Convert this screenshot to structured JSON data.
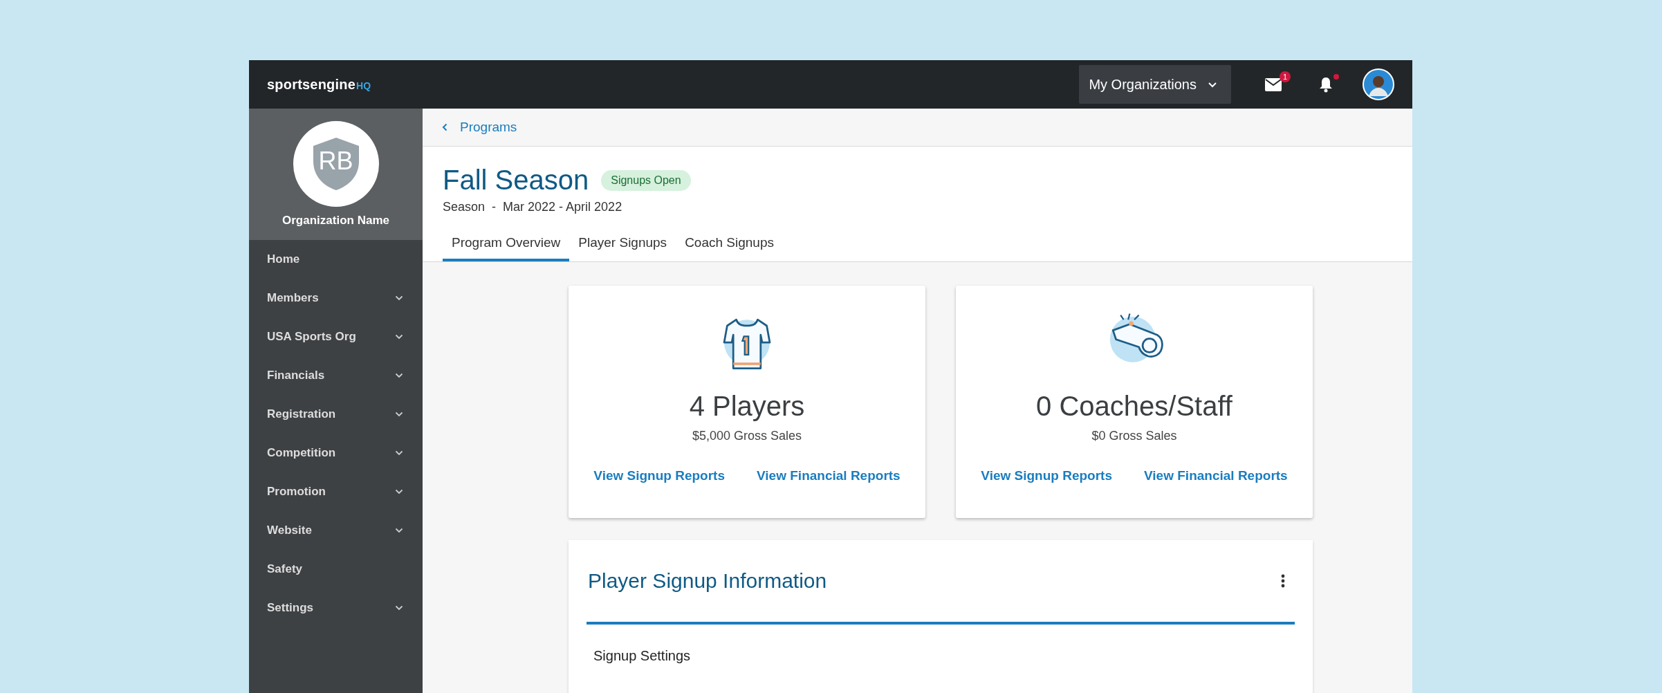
{
  "topbar": {
    "logo": {
      "brand": "sportsengine",
      "suffix": "HQ"
    },
    "org_menu": "My Organizations",
    "mail_badge": "1",
    "notification_dot": true
  },
  "sidebar": {
    "org_initials": "RB",
    "org_name": "Organization Name",
    "items": [
      {
        "label": "Home",
        "kind": "link"
      },
      {
        "label": "Members",
        "kind": "group"
      },
      {
        "label": "USA Sports Org",
        "kind": "group"
      },
      {
        "label": "Financials",
        "kind": "group"
      },
      {
        "label": "Registration",
        "kind": "group"
      },
      {
        "label": "Competition",
        "kind": "group"
      },
      {
        "label": "Promotion",
        "kind": "group"
      },
      {
        "label": "Website",
        "kind": "group"
      },
      {
        "label": "Safety",
        "kind": "link"
      },
      {
        "label": "Settings",
        "kind": "group"
      }
    ]
  },
  "breadcrumb": "Programs",
  "header": {
    "title": "Fall Season",
    "status": "Signups Open",
    "subtitle": "Season  -  Mar 2022 - April 2022"
  },
  "tabs": [
    {
      "label": "Program Overview",
      "selected": true
    },
    {
      "label": "Player Signups",
      "selected": false
    },
    {
      "label": "Coach Signups",
      "selected": false
    }
  ],
  "cards": [
    {
      "kind": "jersey",
      "count": "4 Players",
      "sales": "$5,000 Gross Sales",
      "links": [
        "View Signup Reports",
        "View Financial Reports"
      ]
    },
    {
      "kind": "whistle",
      "count": "0 Coaches/Staff",
      "sales": "$0 Gross Sales",
      "links": [
        "View Signup Reports",
        "View Financial Reports"
      ]
    }
  ],
  "info_panel": {
    "title": "Player Signup Information",
    "section": "Signup Settings"
  }
}
